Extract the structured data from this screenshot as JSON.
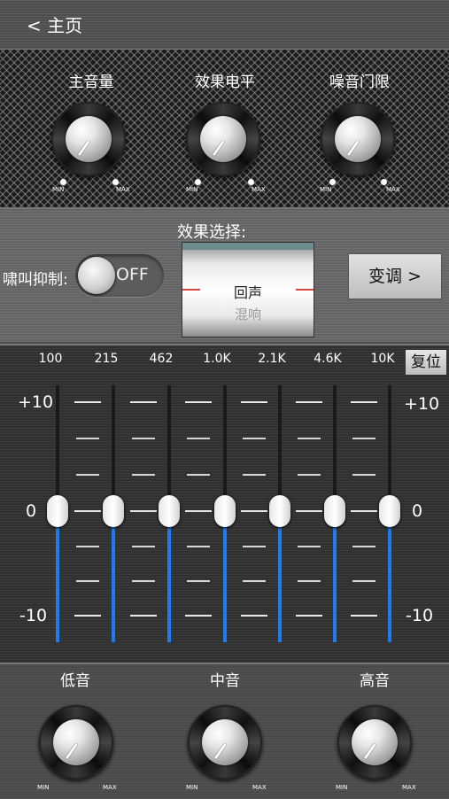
{
  "nav": {
    "back_label": "<  主页"
  },
  "top_knobs": [
    {
      "label": "主音量",
      "min": "MIN",
      "max": "MAX"
    },
    {
      "label": "效果电平",
      "min": "MIN",
      "max": "MAX"
    },
    {
      "label": "噪音门限",
      "min": "MIN",
      "max": "MAX"
    }
  ],
  "howl": {
    "label": "啸叫抑制:",
    "state": "OFF"
  },
  "effect": {
    "title": "效果选择:",
    "selected": "回声",
    "next": "混响"
  },
  "transpose_label": "变调 >",
  "eq": {
    "reset_label": "复位",
    "bands": [
      "100",
      "215",
      "462",
      "1.0K",
      "2.1K",
      "4.6K",
      "10K"
    ],
    "levels": [
      0,
      0,
      0,
      0,
      0,
      0,
      0
    ],
    "axis_left": [
      "+10",
      "0",
      "-10"
    ],
    "axis_right": [
      "+10",
      "0",
      "-10"
    ]
  },
  "bottom_knobs": [
    {
      "label": "低音",
      "min": "MIN",
      "max": "MAX"
    },
    {
      "label": "中音",
      "min": "MIN",
      "max": "MAX"
    },
    {
      "label": "高音",
      "min": "MIN",
      "max": "MAX"
    }
  ],
  "colors": {
    "accent": "#1f7cf0",
    "indicator": "#d9443b"
  }
}
